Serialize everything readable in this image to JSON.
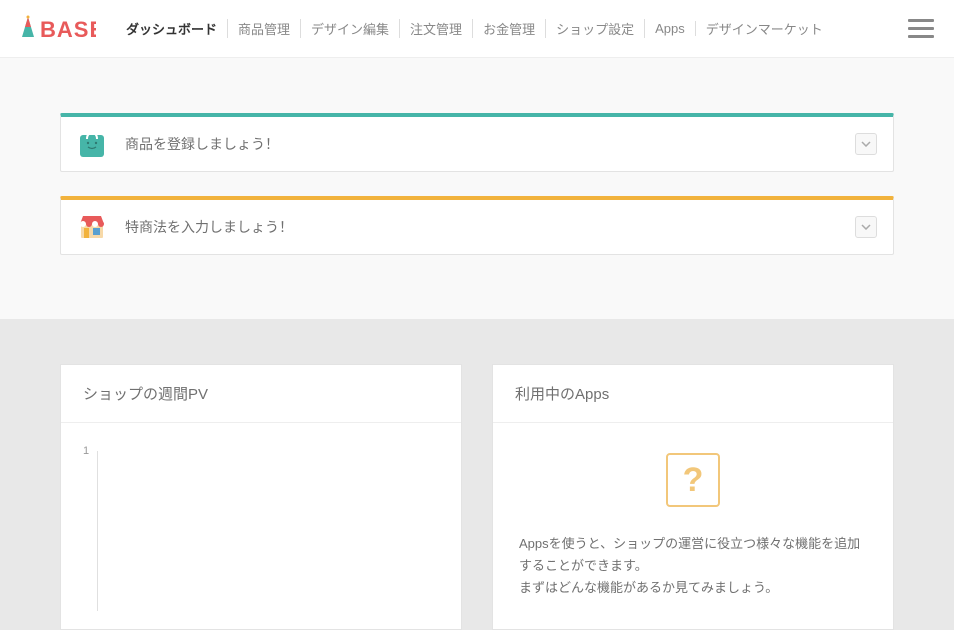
{
  "logo_text": "BASE",
  "nav": {
    "items": [
      {
        "label": "ダッシュボード",
        "active": true
      },
      {
        "label": "商品管理"
      },
      {
        "label": "デザイン編集"
      },
      {
        "label": "注文管理"
      },
      {
        "label": "お金管理"
      },
      {
        "label": "ショップ設定"
      },
      {
        "label": "Apps"
      },
      {
        "label": "デザインマーケット"
      }
    ]
  },
  "notices": {
    "register_product": "商品を登録しましょう！",
    "tokusho": "特商法を入力しましょう！"
  },
  "panels": {
    "pv_title": "ショップの週間PV",
    "apps_title": "利用中のApps",
    "apps_desc_1": "Appsを使うと、ショップの運営に役立つ様々な機能を追加することができます。",
    "apps_desc_2": "まずはどんな機能があるか見てみましょう。"
  },
  "colors": {
    "accent_green": "#46b5a8",
    "accent_orange": "#f2b33d",
    "logo_red": "#e85a5a"
  },
  "chart_data": {
    "type": "line",
    "title": "ショップの週間PV",
    "xlabel": "",
    "ylabel": "",
    "ylim": [
      0,
      1
    ],
    "y_ticks": [
      1
    ],
    "categories": [],
    "values": []
  }
}
